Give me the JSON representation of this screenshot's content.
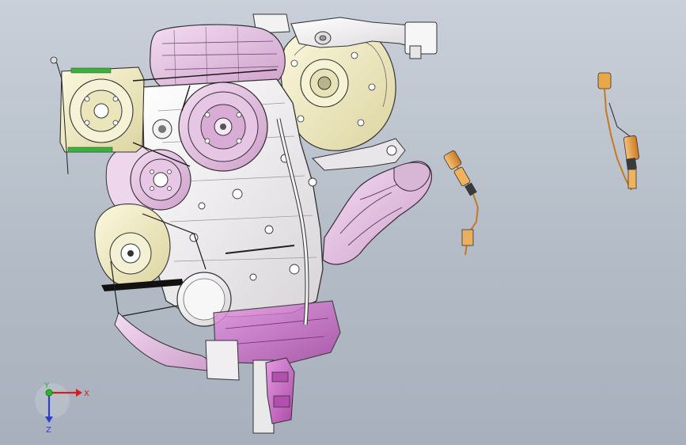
{
  "viewport": {
    "background_top": "#c9d0d9",
    "background_bottom": "#a7b0bc"
  },
  "triad": {
    "x_label": "X",
    "y_label": "Y",
    "z_label": "Z",
    "x_color": "#d21f1f",
    "y_color": "#2bb52b",
    "z_color": "#2a3fd1"
  },
  "model": {
    "parts": [
      "engine-block",
      "crank-pulley",
      "alternator",
      "ac-compressor",
      "idler-pulleys",
      "intake-manifold",
      "exhaust-manifold",
      "oil-filter",
      "oil-pan",
      "dipstick-tube",
      "engine-mount-bracket",
      "oxygen-sensor-1",
      "oxygen-sensor-2"
    ],
    "colors": {
      "pink": "#e8c4e6",
      "magenta": "#c96bc9",
      "cream": "#f3eec8",
      "white": "#f4f2f4",
      "orange": "#e89a3c",
      "outline": "#2a2a2a"
    }
  }
}
